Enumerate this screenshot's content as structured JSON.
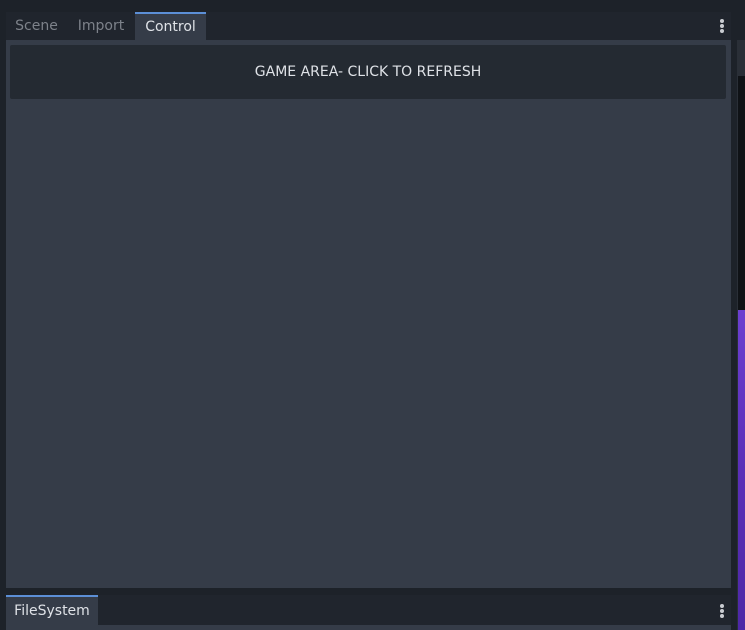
{
  "top_dock": {
    "tabs": [
      {
        "label": "Scene",
        "active": false
      },
      {
        "label": "Import",
        "active": false
      },
      {
        "label": "Control",
        "active": true
      }
    ],
    "menu_icon": "kebab-menu-icon"
  },
  "control_panel": {
    "game_area_button": "GAME AREA- CLICK TO REFRESH"
  },
  "bottom_dock": {
    "tabs": [
      {
        "label": "FileSystem",
        "active": true
      }
    ],
    "menu_icon": "kebab-menu-icon"
  },
  "colors": {
    "background": "#1d2229",
    "panel": "#353c48",
    "tab_accent": "#5c8fd6",
    "button": "#242a32",
    "viewport_purple": "#5a2fb8"
  }
}
